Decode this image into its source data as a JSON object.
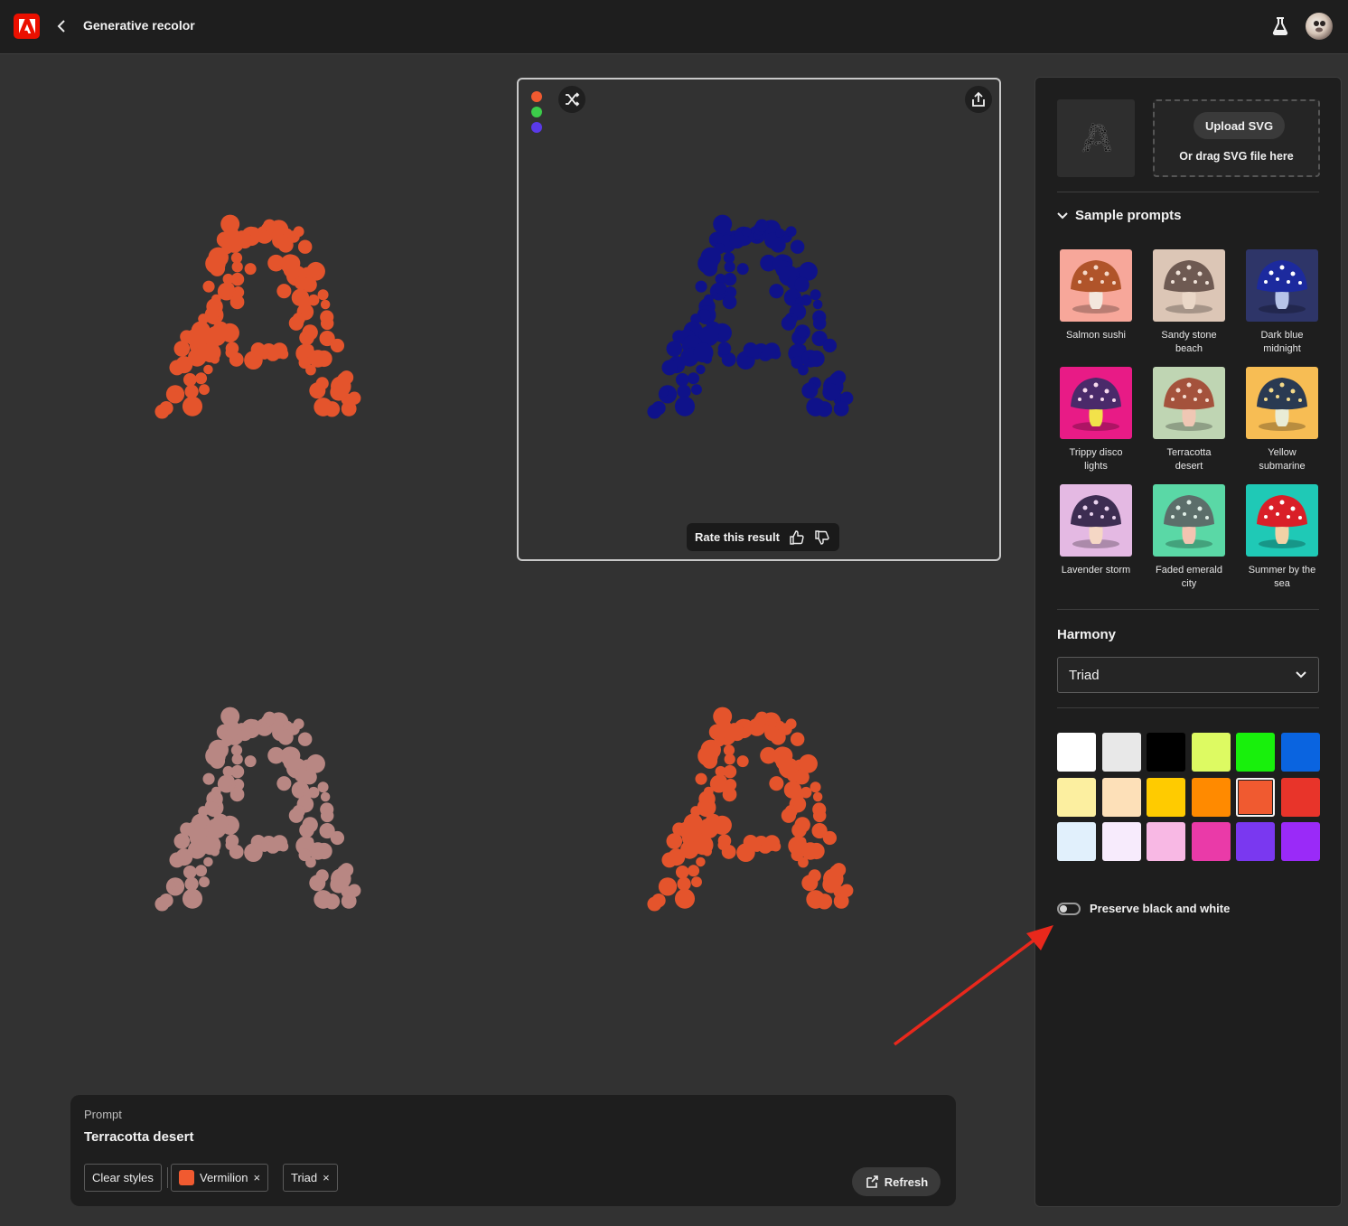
{
  "header": {
    "title": "Generative recolor",
    "logo_icon": "adobe-logo-icon",
    "back_icon": "chevron-left-icon",
    "labs_icon": "flask-icon",
    "avatar_icon": "user-avatar"
  },
  "variations": {
    "colors": {
      "top_left": "#e4542c",
      "selected": "#0f128a",
      "bottom_left": "#b88783",
      "bottom_right": "#e4542c"
    },
    "selected_palette": [
      "#f05a30",
      "#3ccc4a",
      "#5a3ae8"
    ],
    "rate_label": "Rate this result"
  },
  "panel": {
    "upload_button": "Upload SVG",
    "upload_hint": "Or drag SVG file here",
    "sample_prompts_title": "Sample prompts",
    "samples": [
      {
        "label": "Salmon sushi",
        "bg": "#f7a79a",
        "cap": "#b0542a",
        "stem": "#f3e7dd",
        "spots": "#f4d8c8"
      },
      {
        "label": "Sandy stone beach",
        "bg": "#dcc6b6",
        "cap": "#6e5a52",
        "stem": "#ead7c7",
        "spots": "#efe2d8"
      },
      {
        "label": "Dark blue midnight",
        "bg": "#2e3568",
        "cap": "#1c2a9e",
        "stem": "#b7c4e8",
        "spots": "#ffffff"
      },
      {
        "label": "Trippy disco lights",
        "bg": "#e81b86",
        "cap": "#4a2a6a",
        "stem": "#f2e24a",
        "spots": "#f7d9ec"
      },
      {
        "label": "Terracotta desert",
        "bg": "#bfd5b3",
        "cap": "#a4523c",
        "stem": "#efc7b4",
        "spots": "#f4ddd2"
      },
      {
        "label": "Yellow submarine",
        "bg": "#f7bd54",
        "cap": "#2a3a52",
        "stem": "#e9ecd5",
        "spots": "#f3d98a"
      },
      {
        "label": "Lavender storm",
        "bg": "#e4b9e3",
        "cap": "#3d2d52",
        "stem": "#f5d7c5",
        "spots": "#e9d2ee"
      },
      {
        "label": "Faded emerald city",
        "bg": "#5ad8a6",
        "cap": "#5c6e6a",
        "stem": "#f2c4b1",
        "spots": "#dfeee6"
      },
      {
        "label": "Summer by the sea",
        "bg": "#1fc9b6",
        "cap": "#d91f28",
        "stem": "#f2d2a6",
        "spots": "#ffffff"
      }
    ],
    "harmony_title": "Harmony",
    "harmony_value": "Triad",
    "swatches": [
      [
        "#ffffff",
        "#e8e8e8",
        "#000000",
        "#ddfa62",
        "#18f00c",
        "#0a64e0"
      ],
      [
        "#fcefa0",
        "#fde0b8",
        "#ffcb00",
        "#ff8a00",
        "#f05a30",
        "#e8342a"
      ],
      [
        "#e1f0fc",
        "#f7ebfc",
        "#f8b8e4",
        "#ea3aa8",
        "#7a38f0",
        "#9a2af8"
      ]
    ],
    "selected_swatch": "#f05a30",
    "preserve_label": "Preserve black and white"
  },
  "prompt": {
    "caption": "Prompt",
    "value": "Terracotta desert",
    "clear_label": "Clear styles",
    "chips": [
      {
        "label": "Vermilion",
        "color": "#f05a30"
      },
      {
        "label": "Triad"
      }
    ],
    "remove_glyph": "×",
    "refresh_label": "Refresh"
  },
  "annotation": {
    "arrow_color": "#e8281c"
  }
}
